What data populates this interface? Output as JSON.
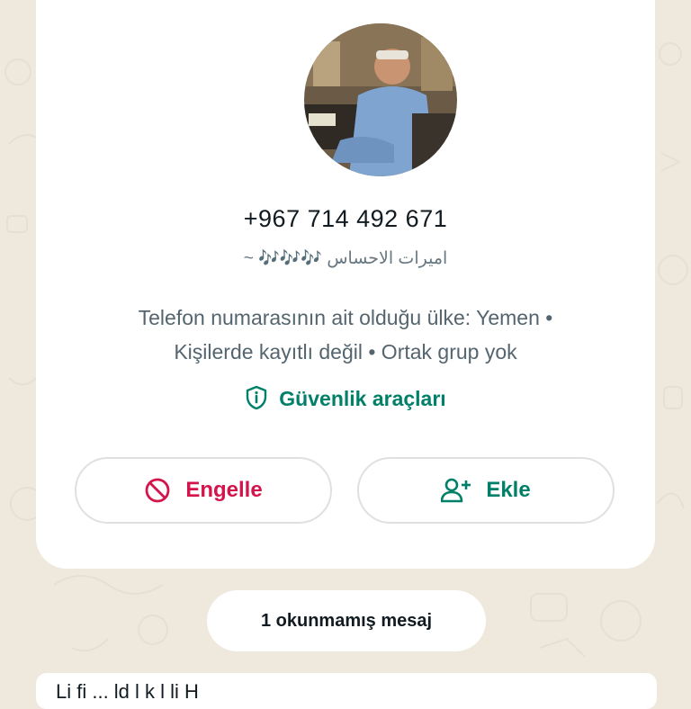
{
  "contact": {
    "phone": "+967 714 492 671",
    "about_prefix": "~",
    "about_notes": "🎶🎶🎶",
    "about_name": "اميرات الاحساس",
    "info_line1": "Telefon numarasının ait olduğu ülke: Yemen •",
    "info_line2": "Kişilerde kayıtlı değil • Ortak grup yok"
  },
  "safety": {
    "label": "Güvenlik araçları"
  },
  "actions": {
    "block_label": "Engelle",
    "add_label": "Ekle"
  },
  "unread": {
    "label": "1 okunmamış mesaj"
  },
  "message_preview": {
    "text": "Li fi  ...  ld  l  k  l  li   H"
  },
  "colors": {
    "accent_green": "#008069",
    "danger_red": "#d4154b",
    "background": "#efe8dd"
  }
}
